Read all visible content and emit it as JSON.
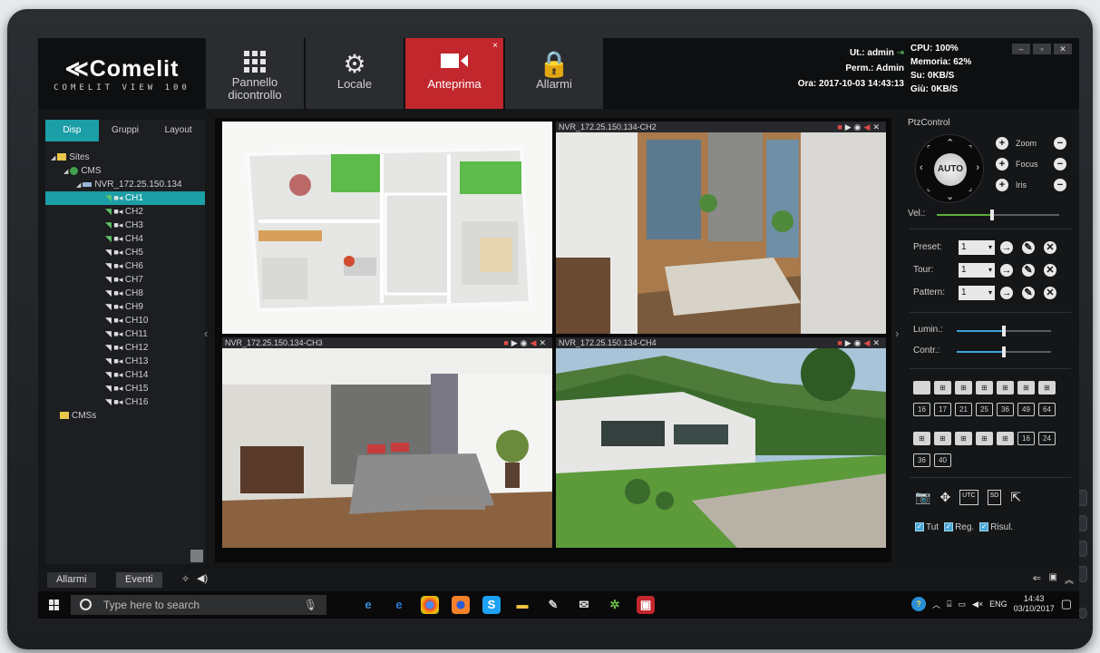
{
  "app": {
    "logo": "Comelit",
    "logo_sub": "COMELIT VIEW 100"
  },
  "nav_tabs": [
    {
      "label": "Pannello dicontrollo",
      "icon": "grid-icon"
    },
    {
      "label": "Locale",
      "icon": "gear-icon"
    },
    {
      "label": "Anteprima",
      "icon": "video-camera-icon",
      "active": true,
      "close": "×"
    },
    {
      "label": "Allarmi",
      "icon": "alarm-gear-icon"
    }
  ],
  "session": {
    "user": "Ut.: admin",
    "perm": "Perm.: Admin",
    "time": "Ora: 2017-10-03 14:43:13"
  },
  "stats": {
    "cpu": "CPU: 100%",
    "memory": "Memoria: 62%",
    "up": "Su: 0KB/S",
    "down": "Giù: 0KB/S"
  },
  "window_controls": [
    "–",
    "▫",
    "✕"
  ],
  "left_tabs": [
    "Disp",
    "Gruppi",
    "Layout"
  ],
  "tree": {
    "sites": "Sites",
    "cms": "CMS",
    "nvr": "NVR_172.25.150.134",
    "channels": [
      "CH1",
      "CH2",
      "CH3",
      "CH4",
      "CH5",
      "CH6",
      "CH7",
      "CH8",
      "CH9",
      "CH10",
      "CH11",
      "CH12",
      "CH13",
      "CH14",
      "CH15",
      "CH16"
    ],
    "cmss": "CMSs"
  },
  "video_cells": [
    {
      "title": "",
      "scene": "floor-plan"
    },
    {
      "title": "NVR_172.25.150.134-CH2",
      "scene": "living-room"
    },
    {
      "title": "NVR_172.25.150.134-CH3",
      "scene": "bedroom"
    },
    {
      "title": "NVR_172.25.150.134-CH4",
      "scene": "villa-exterior"
    }
  ],
  "ptz": {
    "title": "PtzControl",
    "auto": "AUTO",
    "zoom": "Zoom",
    "focus": "Focus",
    "iris": "Iris",
    "vel": "Vel.:",
    "vel_level": 0.45,
    "preset_label": "Preset:",
    "tour_label": "Tour:",
    "pattern_label": "Pattern:",
    "preset_value": "1",
    "tour_value": "1",
    "pattern_value": "1",
    "lumin": "Lumin.:",
    "lumin_level": 0.5,
    "contr": "Contr.:",
    "contr_level": 0.5
  },
  "layout_buttons_row2": [
    "16",
    "17",
    "21",
    "25",
    "36",
    "49",
    "64"
  ],
  "layout_buttons_row3_tail": [
    "16",
    "24"
  ],
  "layout_buttons_row4": [
    "36",
    "40"
  ],
  "tool_labels": [
    "UTC",
    "SD"
  ],
  "checks": [
    "Tut",
    "Reg.",
    "Risul."
  ],
  "bottom": {
    "allarmi": "Allarmi",
    "eventi": "Eventi"
  },
  "taskbar": {
    "search_placeholder": "Type here to search",
    "lang": "ENG",
    "time": "14:43",
    "date": "03/10/2017"
  },
  "colors": {
    "accent_teal": "#1b9ea6",
    "brand_red": "#c1272d",
    "slider_green": "#5fae3a",
    "slider_blue": "#3aa3d9"
  }
}
